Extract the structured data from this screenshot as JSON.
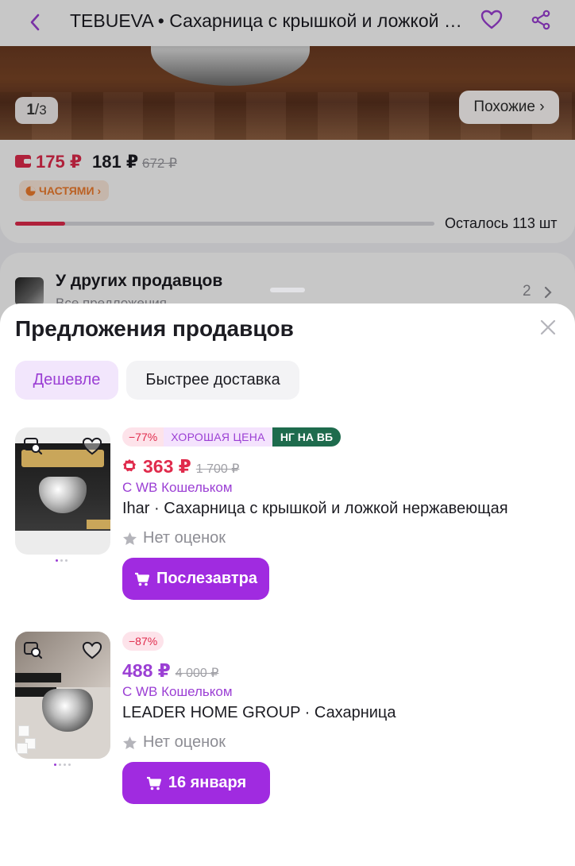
{
  "topbar": {
    "title": "TEBUEVA • Сахарница с крышкой и ложкой нержавеющая"
  },
  "gallery": {
    "counter_current": "1",
    "counter_separator": "/",
    "counter_total": "3",
    "similar_label": "Похожие ›"
  },
  "pricing": {
    "wallet_price": "175 ₽",
    "price": "181 ₽",
    "old_price": "672 ₽",
    "installments_label": "ЧАСТЯМИ",
    "stock_text": "Осталось 113 шт",
    "stock_progress_percent": 12
  },
  "other_sellers": {
    "title": "У других продавцов",
    "subtitle": "Все предложения",
    "count": "2"
  },
  "sheet": {
    "title": "Предложения продавцов",
    "filters": [
      "Дешевле",
      "Быстрее доставка"
    ],
    "active_filter": "Дешевле",
    "offers": [
      {
        "discount": "−77%",
        "tag_good": "ХОРОШАЯ ЦЕНА",
        "tag_ng": "НГ НА ВБ",
        "price": "363 ₽",
        "old_price": "1 700 ₽",
        "wallet_note": "С WB Кошельком",
        "name": "Ihar · Сахарница с крышкой и ложкой нержавеющая",
        "rating": "Нет оценок",
        "button": "Послезавтра",
        "price_color": "#e02b4c"
      },
      {
        "discount": "−87%",
        "price": "488 ₽",
        "old_price": "4 000 ₽",
        "wallet_note": "С WB Кошельком",
        "name": "LEADER HOME GROUP · Сахарница",
        "rating": "Нет оценок",
        "button": "16 января",
        "price_color": "#9b3fd4"
      }
    ]
  },
  "colors": {
    "accent": "#a02be0",
    "accent_text": "#9b3fd4",
    "price_red": "#e02b4c",
    "ng_green": "#1e6b4d"
  },
  "icons": [
    "back-arrow-icon",
    "heart-icon",
    "share-icon",
    "wallet-icon",
    "chevron-right-icon",
    "close-icon",
    "image-search-icon",
    "star-icon",
    "cart-icon"
  ]
}
